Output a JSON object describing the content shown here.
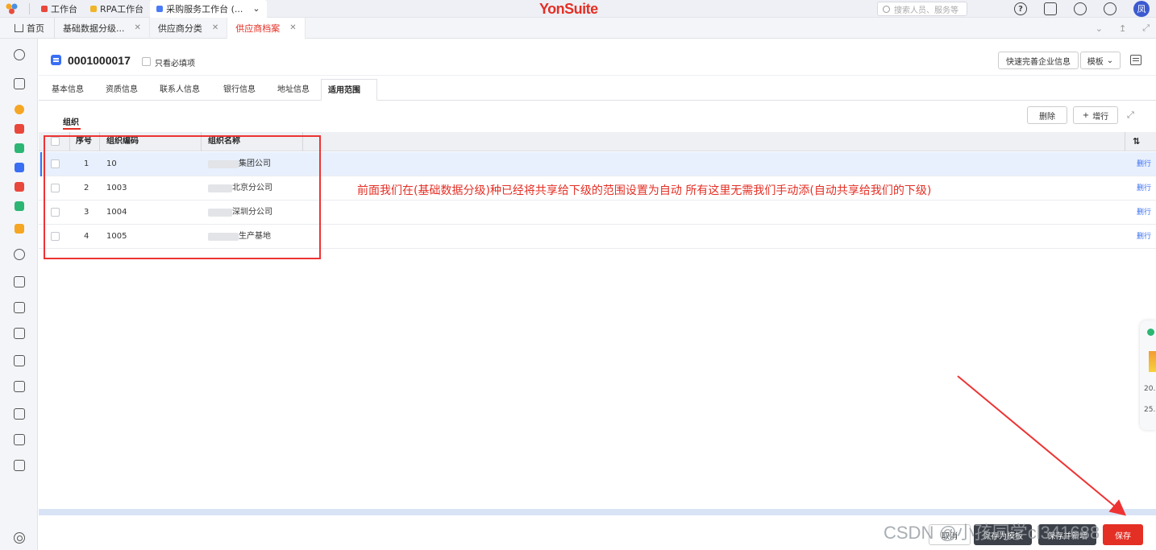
{
  "topbar": {
    "tabs": [
      {
        "label": "工作台",
        "color": "#e9473c"
      },
      {
        "label": "RPA工作台",
        "color": "#f0b429"
      },
      {
        "label": "采购服务工作台 (...",
        "color": "#4a7bf7"
      }
    ],
    "brand": "YonSuite",
    "search_placeholder": "搜索人员、服务等",
    "avatar_text": "凤"
  },
  "tabbar": {
    "home_label": "首页",
    "tabs": [
      {
        "label": "基础数据分级..."
      },
      {
        "label": "供应商分类"
      },
      {
        "label": "供应商档案"
      }
    ]
  },
  "record": {
    "code": "0001000017",
    "required_only_label": "只看必填项",
    "quick_fill_label": "快速完善企业信息",
    "template_label": "模板"
  },
  "subtabs": [
    "基本信息",
    "资质信息",
    "联系人信息",
    "银行信息",
    "地址信息",
    "适用范围"
  ],
  "section": {
    "label": "组织",
    "delete_label": "删除",
    "add_row_label": "增行"
  },
  "table": {
    "headers": {
      "seq": "序号",
      "code": "组织编码",
      "name": "组织名称"
    },
    "rows": [
      {
        "seq": "1",
        "code": "10",
        "name": "集团公司",
        "action": "删行"
      },
      {
        "seq": "2",
        "code": "1003",
        "name": "北京分公司",
        "action": "删行"
      },
      {
        "seq": "3",
        "code": "1004",
        "name": "深圳分公司",
        "action": "删行"
      },
      {
        "seq": "4",
        "code": "1005",
        "name": "生产基地",
        "action": "删行"
      }
    ]
  },
  "annotation": "前面我们在(基础数据分级)种已经将共享给下级的范围设置为自动 所有这里无需我们手动添(自动共享给我们的下级)",
  "float_widget": {
    "line1": "20.",
    "line2": "25."
  },
  "footer": {
    "cancel_label": "取消",
    "save_template_label": "保存为模板",
    "save_add_label": "保存并新增",
    "save_label": "保存",
    "watermark": "CSDN @小孩同学cl341688"
  },
  "colors": {
    "brand_red": "#e42f25",
    "accent_blue": "#3a6ff4",
    "annotation_red": "#e42f25"
  }
}
